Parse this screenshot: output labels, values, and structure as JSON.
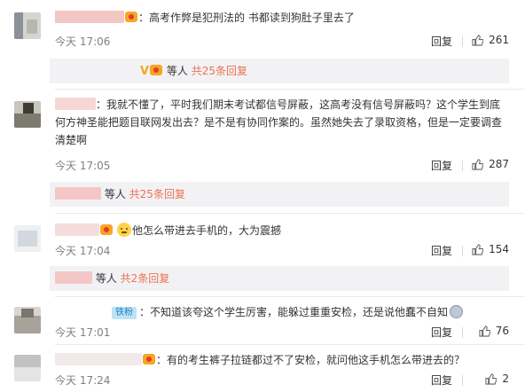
{
  "colors": {
    "link": "#eb7350",
    "meta": "#808080",
    "reply_bg": "#f2f2f5"
  },
  "icons": {
    "like": "thumbs-up-icon",
    "vip": "vip-heart-badge-icon"
  },
  "comments": [
    {
      "text": "：高考作弊是犯刑法的 书都读到狗肚子里去了",
      "time": "今天 17:06",
      "reply": "回复",
      "likes": "261"
    },
    {
      "text": "：我就不懂了，平时我们期末考试都信号屏蔽，这高考没有信号屏蔽吗？这个学生到底何方神圣能把题目联网发出去？是不是有协同作案的。虽然她失去了录取资格，但是一定要调查清楚啊",
      "time": "今天 17:05",
      "reply": "回复",
      "likes": "287"
    },
    {
      "text": "他怎么带进去手机的，大为震撼",
      "time": "今天 17:04",
      "reply": "回复",
      "likes": "154"
    },
    {
      "badge": "铁粉",
      "text": "：不知道该夸这个学生厉害，能躲过重重安检，还是说他蠢不自知",
      "time": "今天 17:01",
      "reply": "回复",
      "likes": "76"
    },
    {
      "text": "：有的考生裤子拉链都过不了安检，就问他这手机怎么带进去的？",
      "time": "今天 17:24",
      "reply": "回复",
      "likes": "2"
    }
  ],
  "reply_threads": [
    {
      "label": "等人",
      "count": "共25条回复"
    },
    {
      "label": "等人",
      "count": "共25条回复"
    },
    {
      "label": "等人",
      "count": "共2条回复"
    }
  ]
}
